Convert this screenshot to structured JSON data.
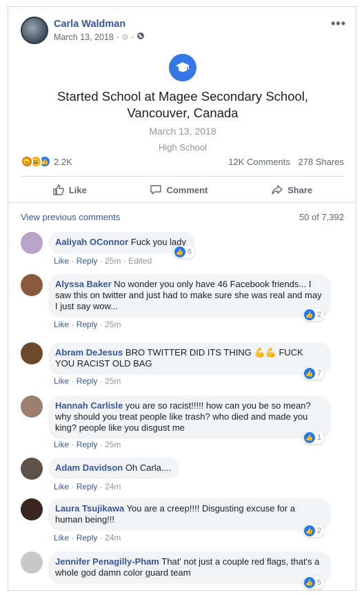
{
  "post": {
    "author": "Carla Waldman",
    "date": "March 13, 2018",
    "meta_sep": "·",
    "more_label": "•••"
  },
  "life_event": {
    "title_line1": "Started School at Magee Secondary School,",
    "title_line2": "Vancouver, Canada",
    "date": "March 13, 2018",
    "subtitle": "High School",
    "icon": "graduation-cap-icon"
  },
  "reactions": {
    "count": "2.2K",
    "types": [
      "angry",
      "haha",
      "like"
    ],
    "comments": "12K Comments",
    "shares": "278 Shares"
  },
  "actions": {
    "like": "Like",
    "comment": "Comment",
    "share": "Share"
  },
  "comments_header": {
    "view_previous": "View previous comments",
    "count": "50 of 7,392"
  },
  "comment_actions": {
    "like": "Like",
    "reply": "Reply",
    "edited": "Edited",
    "sep": "·"
  },
  "comments": [
    {
      "name": "Aaliyah OConnor",
      "text": "Fuck you lady",
      "time": "25m",
      "likes": "6",
      "edited": true,
      "avatar_color": "#b9a3c6"
    },
    {
      "name": "Alyssa Baker",
      "text": "No wonder you only have 46 Facebook friends... I saw this on twitter and just had to make sure she was real and may I just say wow...",
      "time": "25m",
      "likes": "2",
      "avatar_color": "#8a5a3c"
    },
    {
      "name": "Abram DeJesus",
      "text": "BRO TWITTER DID ITS THING 💪💪 FUCK YOU RACIST OLD BAG",
      "time": "25m",
      "likes": "7",
      "avatar_color": "#6b4a2b"
    },
    {
      "name": "Hannah Carlisle",
      "text": "you are so racist!!!!! how can you be so mean? why should you treat people like trash? who died and made you king? people like you disgust me",
      "time": "25m",
      "likes": "1",
      "avatar_color": "#9c7f6e"
    },
    {
      "name": "Adam Davidson",
      "text": "Oh Carla....",
      "time": "24m",
      "likes": "",
      "avatar_color": "#5d5148"
    },
    {
      "name": "Laura Tsujikawa",
      "text": "You are a creep!!!! Disgusting excuse for a human being!!!",
      "time": "24m",
      "likes": "2",
      "avatar_color": "#3a2620"
    },
    {
      "name": "Jennifer Penagilly-Pham",
      "text": "That' not just a couple red flags, that's a whole god damn color guard team",
      "time": "",
      "likes": "5",
      "avatar_color": "#c8c8c8"
    }
  ],
  "colors": {
    "link": "#385898",
    "name": "#365899",
    "accent": "#3578e5",
    "bubble": "#f2f3f5"
  }
}
